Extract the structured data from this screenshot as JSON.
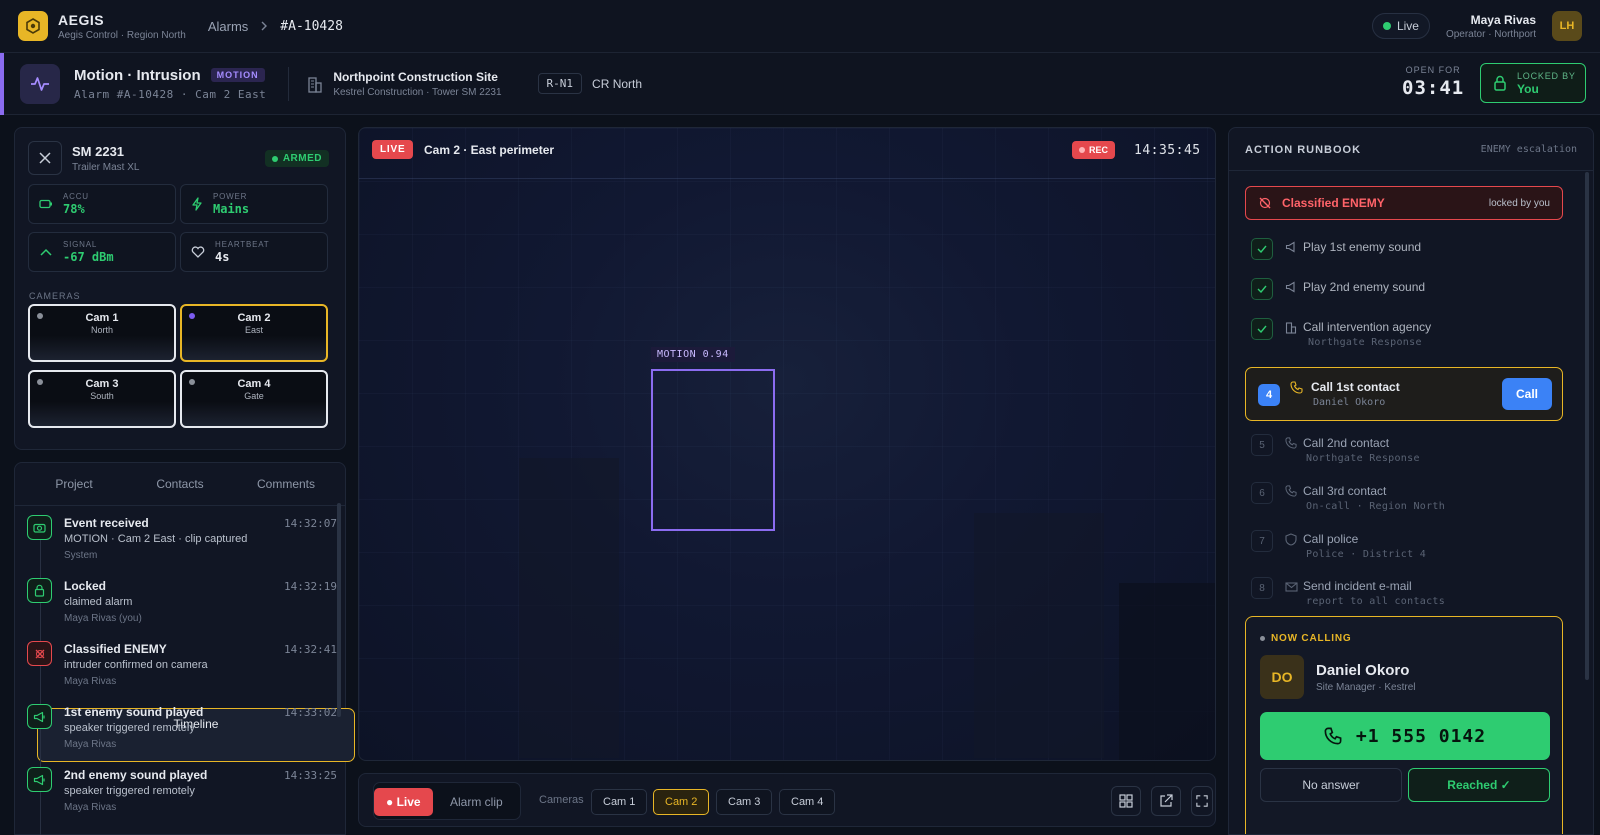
{
  "topbar": {
    "app_name": "AEGIS",
    "app_sub": "Aegis Control · Region North",
    "crumb_alarms": "Alarms",
    "crumb_current": "#A-10428",
    "live_label": "Live",
    "user_name": "Maya Rivas",
    "user_role": "Operator · Northport",
    "user_initials": "LH"
  },
  "alarm": {
    "title": "Motion · Intrusion",
    "badge": "MOTION",
    "subtitle": "Alarm #A-10428 · Cam 2 East",
    "site_name": "Northpoint Construction Site",
    "site_sub": "Kestrel Construction · Tower SM 2231",
    "route_code": "R-N1",
    "route_name": "CR North",
    "open_for_label": "OPEN FOR",
    "open_for_value": "03:41",
    "locked_label": "LOCKED BY",
    "locked_value": "You"
  },
  "device": {
    "name": "SM 2231",
    "model": "Trailer Mast XL",
    "status": "ARMED",
    "stats": [
      {
        "label": "ACCU",
        "value": "78%",
        "icon": "battery-icon",
        "color": "#2ecc71"
      },
      {
        "label": "POWER",
        "value": "Mains",
        "icon": "bolt-icon",
        "color": "#2ecc71"
      },
      {
        "label": "SIGNAL",
        "value": "-67 dBm",
        "icon": "signal-icon",
        "color": "#2ecc71"
      },
      {
        "label": "HEARTBEAT",
        "value": "4s",
        "icon": "heart-icon",
        "color": "#e6e9ef"
      }
    ],
    "cameras_label": "CAMERAS",
    "cameras": [
      {
        "name": "Cam 1",
        "pos": "North"
      },
      {
        "name": "Cam 2",
        "pos": "East"
      },
      {
        "name": "Cam 3",
        "pos": "South"
      },
      {
        "name": "Cam 4",
        "pos": "Gate"
      }
    ]
  },
  "timeline": {
    "tabs": [
      "Timeline",
      "Project",
      "Contacts",
      "Comments"
    ],
    "items": [
      {
        "title": "Event received",
        "desc": "MOTION · Cam 2 East · clip captured",
        "who": "System",
        "time": "14:32:07",
        "icon": "camera-icon"
      },
      {
        "title": "Locked",
        "desc": "claimed alarm",
        "who": "Maya Rivas (you)",
        "time": "14:32:19",
        "icon": "lock-icon"
      },
      {
        "title": "Classified ENEMY",
        "desc": "intruder confirmed on camera",
        "who": "Maya Rivas",
        "time": "14:32:41",
        "icon": "target-off-icon"
      },
      {
        "title": "1st enemy sound played",
        "desc": "speaker triggered remotely",
        "who": "Maya Rivas",
        "time": "14:33:02",
        "icon": "megaphone-icon"
      },
      {
        "title": "2nd enemy sound played",
        "desc": "speaker triggered remotely",
        "who": "Maya Rivas",
        "time": "14:33:25",
        "icon": "megaphone-icon"
      }
    ]
  },
  "video": {
    "live_badge": "LIVE",
    "title": "Cam 2 · East perimeter",
    "rec": "REC",
    "time": "14:35:45",
    "detection_label": "MOTION 0.94"
  },
  "controls": {
    "live": "● Live",
    "clip": "Alarm clip",
    "cameras_label": "Cameras",
    "cams": [
      "Cam 1",
      "Cam 2",
      "Cam 3",
      "Cam 4"
    ]
  },
  "runbook": {
    "title": "ACTION RUNBOOK",
    "escalation": "ENEMY escalation",
    "classified": "Classified ENEMY",
    "classified_note": "locked by you",
    "done_steps": [
      {
        "title": "Play 1st enemy sound",
        "sub": ""
      },
      {
        "title": "Play 2nd enemy sound",
        "sub": ""
      },
      {
        "title": "Call intervention agency",
        "sub": "Northgate Response"
      }
    ],
    "active_step": {
      "num": "4",
      "title": "Call 1st contact",
      "sub": "Daniel Okoro",
      "button": "Call"
    },
    "future_steps": [
      {
        "num": "5",
        "title": "Call 2nd contact",
        "sub": "Northgate Response"
      },
      {
        "num": "6",
        "title": "Call 3rd contact",
        "sub": "On-call · Region North"
      },
      {
        "num": "7",
        "title": "Call police",
        "sub": "Police · District 4"
      },
      {
        "num": "8",
        "title": "Send incident e-mail",
        "sub": "report to all contacts"
      }
    ],
    "calling": {
      "label": "NOW CALLING",
      "initials": "DO",
      "name": "Daniel Okoro",
      "role": "Site Manager · Kestrel",
      "phone": "+1 555 0142",
      "no_answer": "No answer",
      "reached": "Reached ✓"
    }
  },
  "colors": {
    "accent": "#8b6cf0",
    "green": "#2ecc71",
    "red": "#e5484d",
    "amber": "#e8b626",
    "blue": "#3b82f6"
  }
}
